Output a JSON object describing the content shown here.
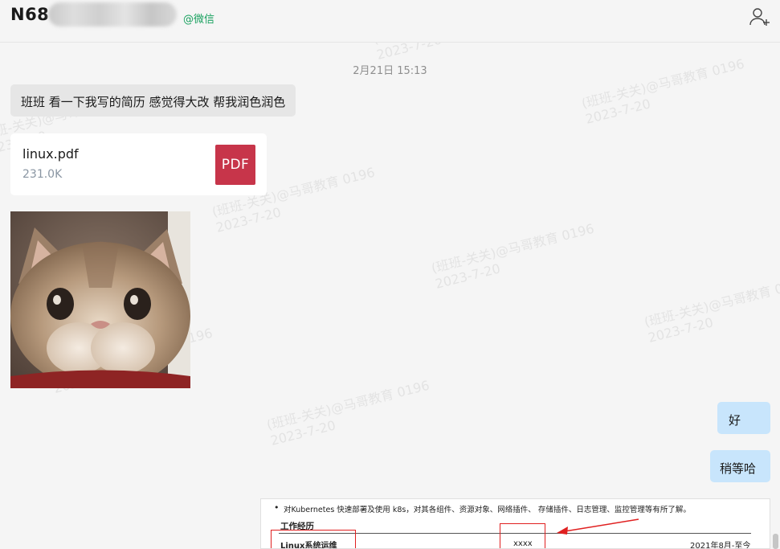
{
  "header": {
    "contact_name": "N68",
    "source_tag": "@微信",
    "add_user_icon": "add-user-icon"
  },
  "chat": {
    "timestamp": "2月21日 15:13",
    "messages": [
      {
        "side": "in",
        "type": "text",
        "text": "班班 看一下我写的简历 感觉得大改 帮我润色润色"
      },
      {
        "side": "in",
        "type": "file",
        "file_name": "linux.pdf",
        "file_size": "231.0K",
        "file_type": "PDF"
      },
      {
        "side": "in",
        "type": "image",
        "icon": "cat-photo"
      },
      {
        "side": "out",
        "type": "text",
        "text": "好"
      },
      {
        "side": "out",
        "type": "text",
        "text": "稍等哈"
      },
      {
        "side": "out",
        "type": "image",
        "icon": "resume-screenshot"
      }
    ]
  },
  "resume": {
    "bullet": "对Kubernetes 快速部署及使用 k8s，对其各组件、资源对象、网络插件、 存储插件、日志管理、监控管理等有所了解。",
    "section": "工作经历",
    "job_title": "Linux系统运维",
    "company": "xxxx",
    "period": "2021年8月-至今"
  },
  "watermark": {
    "lines": [
      {
        "text": "(班班-关关)@马哥教育 0196",
        "date": "2023-7-20"
      },
      {
        "text": "(班班-关关)@马哥教育 0196",
        "date": "2023-7-20"
      },
      {
        "text": "(班班-关关)@马哥教育 0196",
        "date": "2023-7-20"
      },
      {
        "text": "(班班-关关)@马哥教育 0196",
        "date": "2023-7-20"
      },
      {
        "text": "(班班-关关)@马哥教育 0196",
        "date": "2023-7-20"
      },
      {
        "text": "(班班-关关)@马哥教育 0196",
        "date": "2023-7-20"
      },
      {
        "text": "(班班-关关)@马哥教育 0196",
        "date": "2023-7-20"
      },
      {
        "text": "(班班-关关)@马哥教育 0196",
        "date": "2023-7-20"
      }
    ]
  },
  "colors": {
    "background": "#f5f5f5",
    "incoming_bubble": "#e6e6e6",
    "outgoing_bubble": "#c8e5fc",
    "source_tag": "#19a15f",
    "pdf_badge": "#c7354a",
    "annotation_red": "#e02020"
  }
}
